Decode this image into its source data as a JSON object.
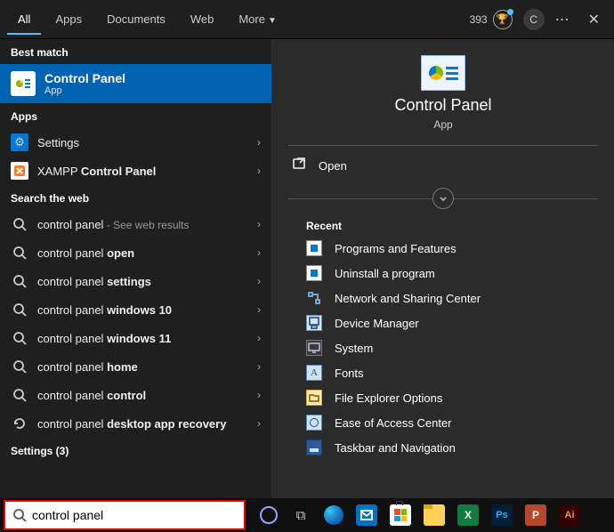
{
  "topbar": {
    "tabs": [
      "All",
      "Apps",
      "Documents",
      "Web",
      "More"
    ],
    "active_tab": 0,
    "points": "393",
    "avatar_initial": "C"
  },
  "left": {
    "best_match_label": "Best match",
    "best_match": {
      "title": "Control Panel",
      "subtitle": "App"
    },
    "apps_label": "Apps",
    "apps": [
      {
        "name": "Settings"
      },
      {
        "name_pre": "XAMPP ",
        "name_bold": "Control Panel"
      }
    ],
    "web_label": "Search the web",
    "web": [
      {
        "pre": "control panel",
        "bold": "",
        "suffix": " - See web results"
      },
      {
        "pre": "control panel ",
        "bold": "open",
        "suffix": ""
      },
      {
        "pre": "control panel ",
        "bold": "settings",
        "suffix": ""
      },
      {
        "pre": "control panel ",
        "bold": "windows 10",
        "suffix": ""
      },
      {
        "pre": "control panel ",
        "bold": "windows 11",
        "suffix": ""
      },
      {
        "pre": "control panel ",
        "bold": "home",
        "suffix": ""
      },
      {
        "pre": "control panel ",
        "bold": "control",
        "suffix": ""
      },
      {
        "pre": "control panel ",
        "bold": "desktop app recovery",
        "suffix": "",
        "loop": true
      }
    ],
    "settings_label": "Settings (3)"
  },
  "right": {
    "title": "Control Panel",
    "subtitle": "App",
    "open_label": "Open",
    "recent_label": "Recent",
    "recent": [
      "Programs and Features",
      "Uninstall a program",
      "Network and Sharing Center",
      "Device Manager",
      "System",
      "Fonts",
      "File Explorer Options",
      "Ease of Access Center",
      "Taskbar and Navigation"
    ]
  },
  "search": {
    "value": "control panel"
  },
  "taskbar_apps": [
    "cortana",
    "taskview",
    "edge",
    "mail",
    "store",
    "explorer",
    "excel",
    "ps",
    "pp",
    "ai"
  ]
}
